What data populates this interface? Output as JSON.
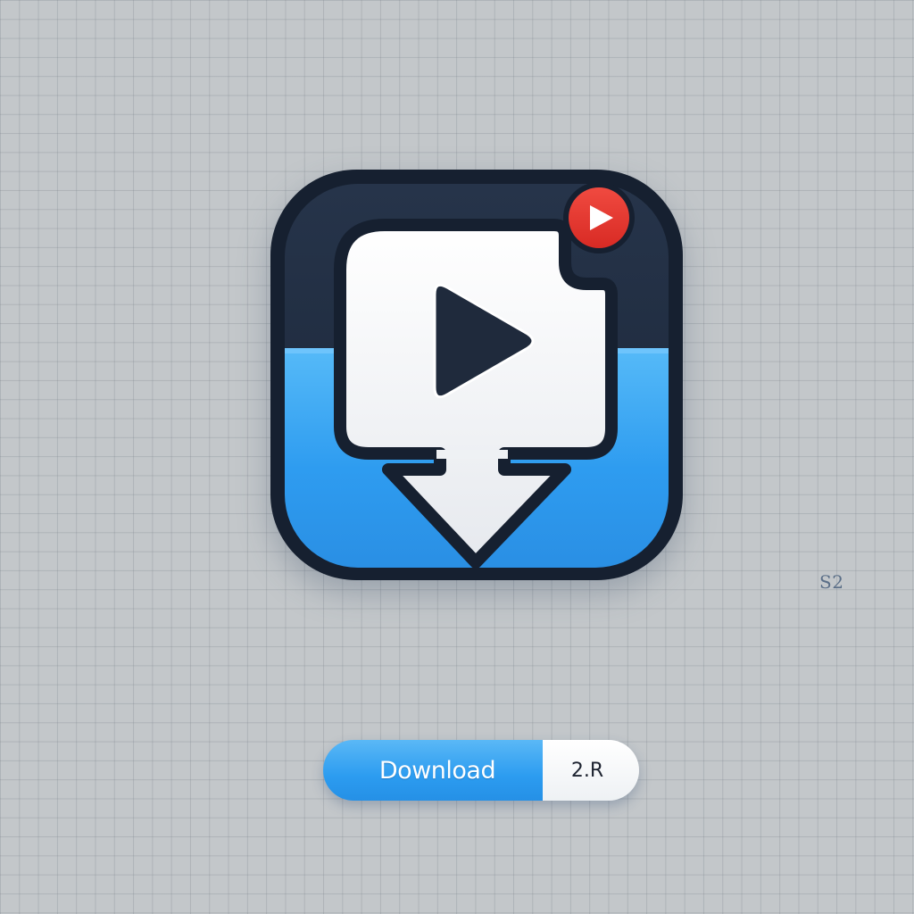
{
  "corner_text": "S2",
  "download": {
    "label": "Download",
    "version": "2.R"
  },
  "icons": {
    "main": "video-download-app-icon",
    "play": "play-icon",
    "badge": "red-play-badge-icon",
    "arrow": "download-arrow-icon"
  },
  "colors": {
    "background": "#c3c7ca",
    "icon_outline": "#1b2535",
    "icon_blue": "#2e9cf0",
    "badge_red": "#e8322d",
    "button_blue": "#2c9cf0"
  }
}
